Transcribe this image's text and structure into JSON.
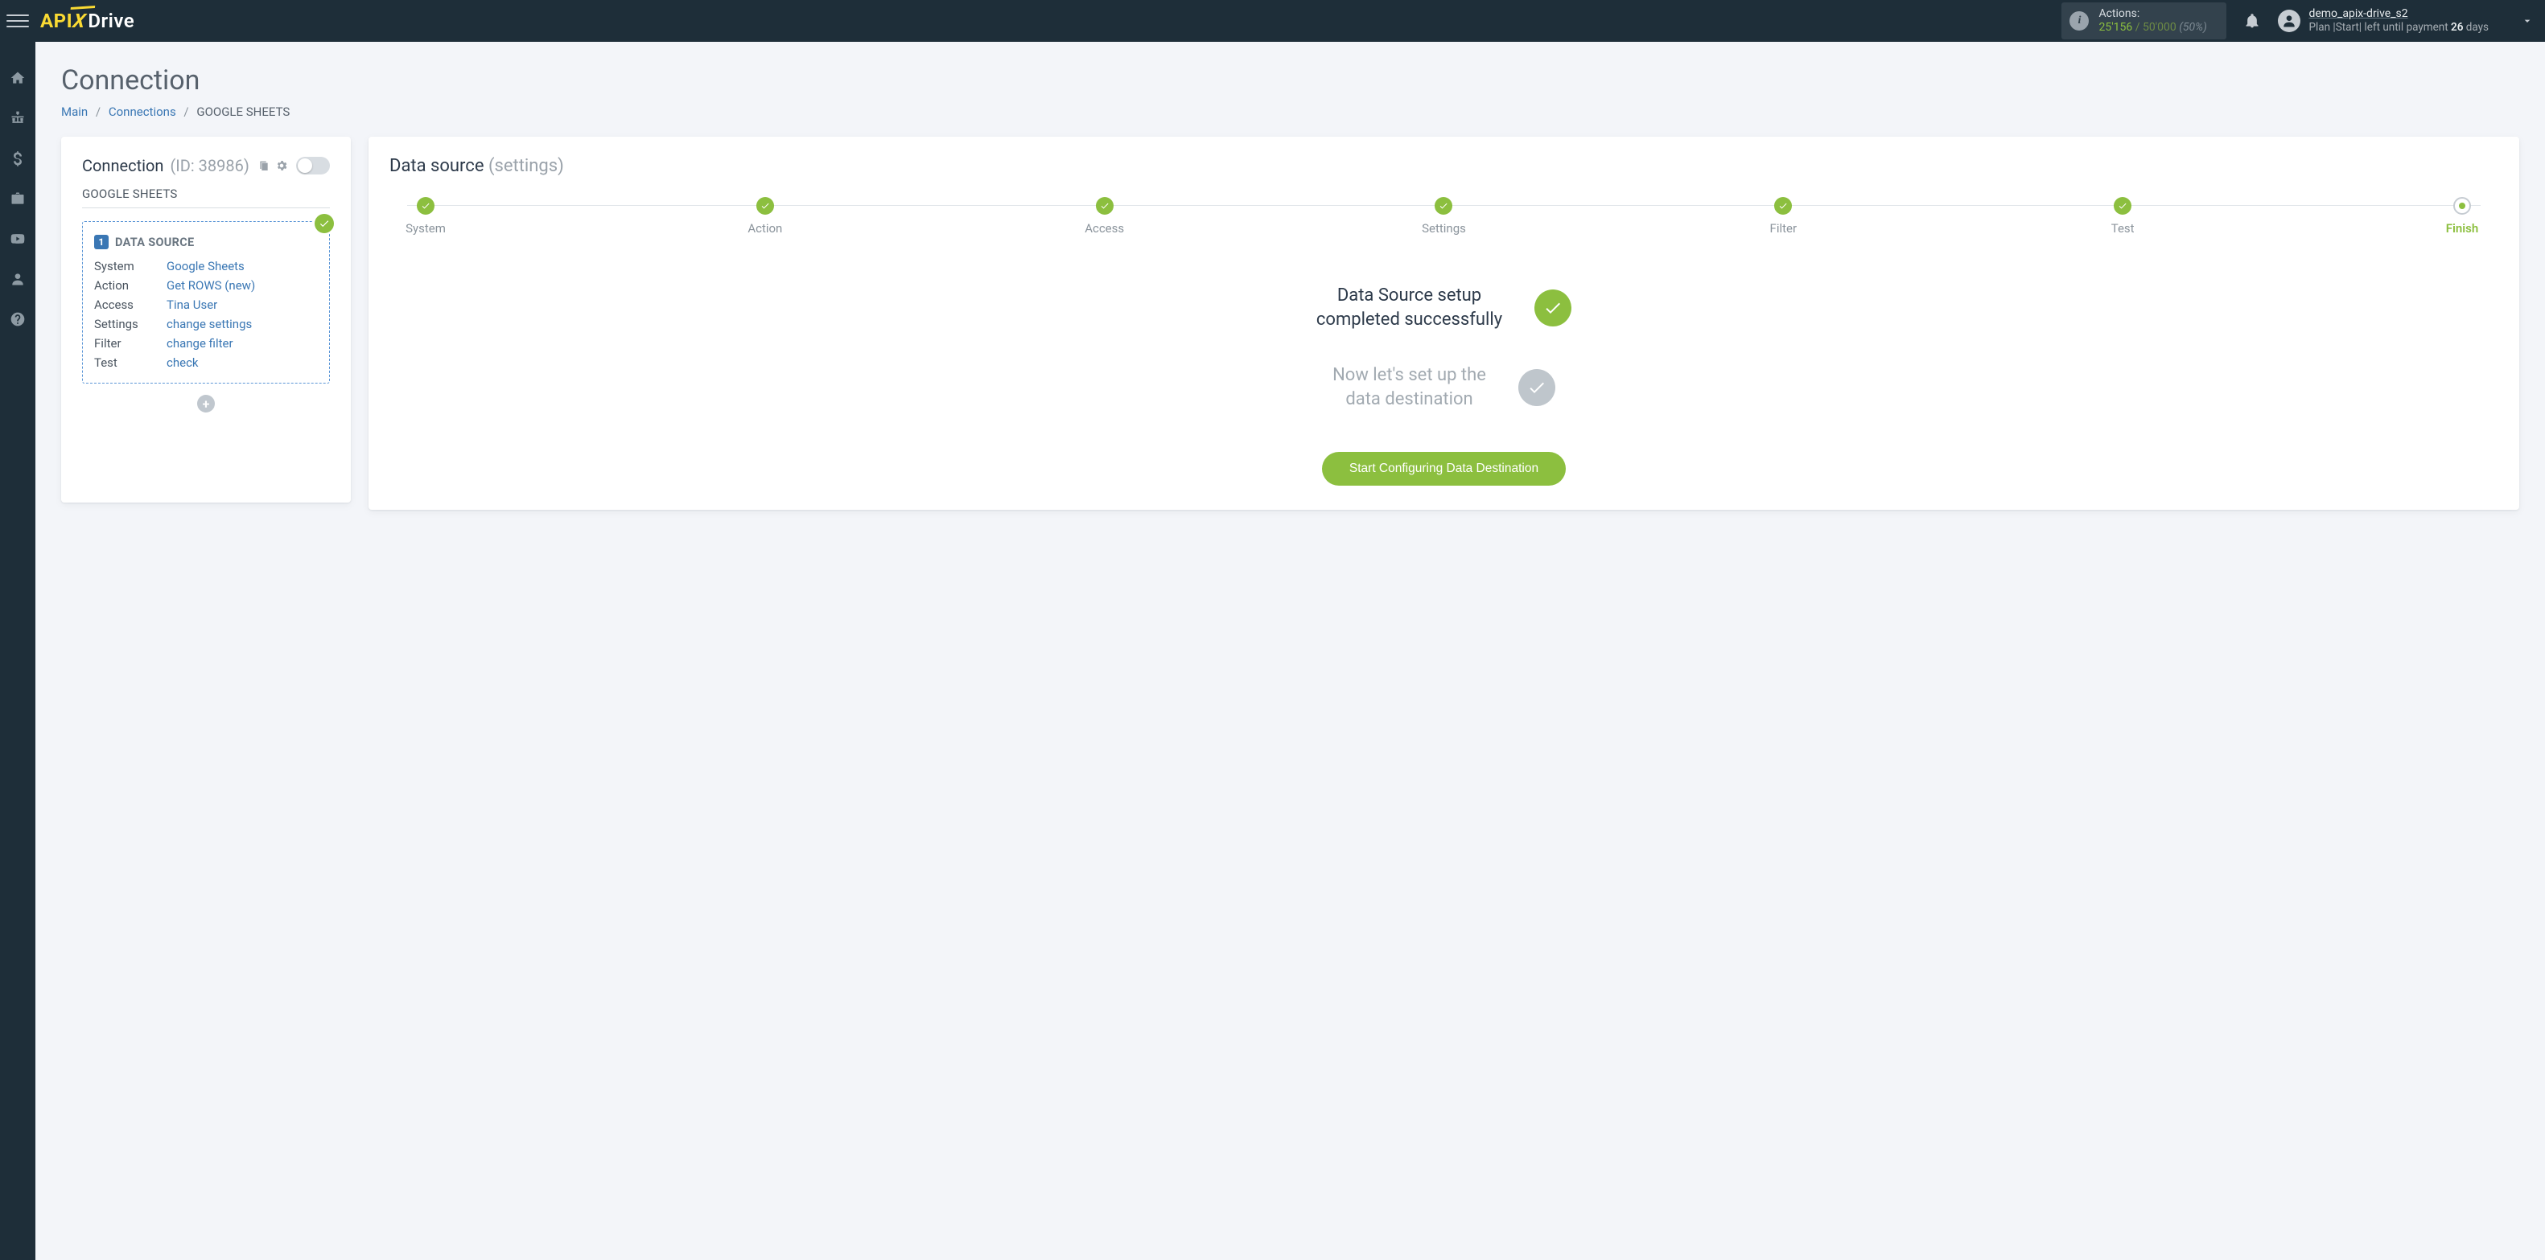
{
  "header": {
    "logo": {
      "api": "API",
      "x": "X",
      "drive": "Drive"
    },
    "actions": {
      "label": "Actions:",
      "used": "25'156",
      "separator": " / ",
      "total": "50'000",
      "pct": "(50%)"
    },
    "user": {
      "name": "demo_apix-drive_s2",
      "plan_prefix": "Plan |Start|  left until payment ",
      "plan_days": "26",
      "plan_suffix": " days"
    }
  },
  "sidebar": [
    "home",
    "sitemap",
    "dollar",
    "briefcase",
    "youtube",
    "user",
    "help"
  ],
  "page": {
    "title": "Connection",
    "breadcrumb": {
      "main": "Main",
      "connections": "Connections",
      "current": "GOOGLE SHEETS"
    }
  },
  "left_card": {
    "title": "Connection",
    "id_label": "(ID: 38986)",
    "service": "GOOGLE SHEETS",
    "datasource": {
      "badge": "1",
      "title": "DATA SOURCE",
      "rows": [
        {
          "k": "System",
          "v": "Google Sheets"
        },
        {
          "k": "Action",
          "v": "Get ROWS (new)"
        },
        {
          "k": "Access",
          "v": "Tina User"
        },
        {
          "k": "Settings",
          "v": "change settings"
        },
        {
          "k": "Filter",
          "v": "change filter"
        },
        {
          "k": "Test",
          "v": "check"
        }
      ]
    }
  },
  "right_card": {
    "title": "Data source",
    "subtitle": "(settings)",
    "steps": [
      "System",
      "Action",
      "Access",
      "Settings",
      "Filter",
      "Test",
      "Finish"
    ],
    "success_line1": "Data Source setup",
    "success_line2": "completed successfully",
    "next_line1": "Now let's set up the",
    "next_line2": "data destination",
    "cta": "Start Configuring Data Destination"
  }
}
